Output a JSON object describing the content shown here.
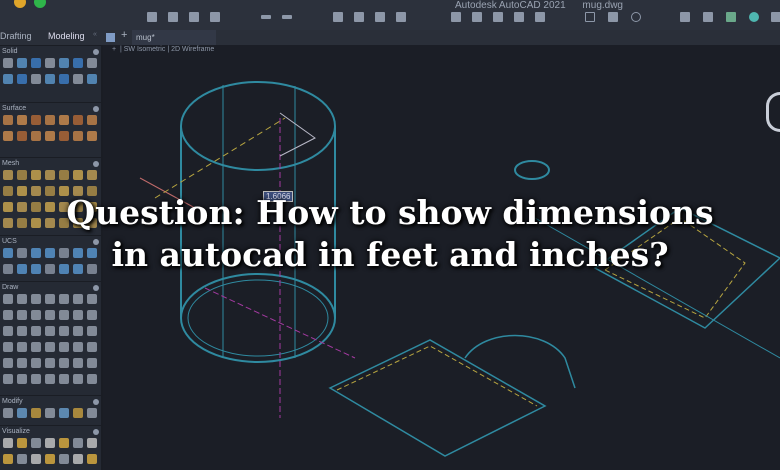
{
  "window": {
    "app_title": "Autodesk AutoCAD 2021",
    "file_name": "mug.dwg"
  },
  "workspace_tabs": [
    {
      "label": "Drafting"
    },
    {
      "label": "Modeling"
    }
  ],
  "document_tab": {
    "label": "mug*"
  },
  "viewport": {
    "view": "SW Isometric",
    "visual_style": "2D Wireframe",
    "dimension_input": "1.6066"
  },
  "palette_sections": [
    {
      "label": "Solid"
    },
    {
      "label": "Surface"
    },
    {
      "label": "Mesh"
    },
    {
      "label": "UCS"
    },
    {
      "label": "Draw"
    },
    {
      "label": "Modify"
    },
    {
      "label": "Visualize"
    }
  ],
  "headline": {
    "line1": "Question: How to show dimensions",
    "line2": "in autocad in feet and inches?"
  }
}
